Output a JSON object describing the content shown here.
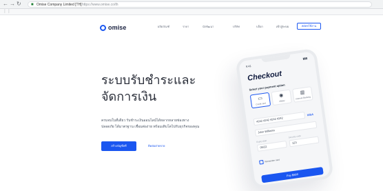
{
  "browser": {
    "back_icon": "back-arrow-icon",
    "forward_icon": "forward-arrow-icon",
    "reload_icon": "reload-icon",
    "lock_icon": "lock-icon",
    "site_label": "Omise Company Limited [TH]",
    "url": "https://www.omise.co/th"
  },
  "site": {
    "brand": "omise",
    "nav": [
      "ผลิตภัณฑ์",
      "ราคา",
      "นักพัฒนา",
      "บริษัท",
      "บล็อก"
    ],
    "login": "เข้าสู่ระบบ",
    "signup": "สมัครใช้งาน"
  },
  "hero": {
    "title_line1": "ระบบรับชำระและ",
    "title_line2": "จัดการเงิน",
    "subtitle_line1": "ครบจบในที่เดียว รับชำระเงินออนไลน์ได้หลากหลายช่องทาง",
    "subtitle_line2": "ปลอดภัย ได้มาตรฐาน เชื่อมต่อง่าย พร้อมเติบโตไปกับธุรกิจของคุณ",
    "cta_primary": "สร้างบัญชีฟรี",
    "cta_secondary": "ติดต่อฝ่ายขาย"
  },
  "phone": {
    "time": "9:41",
    "signal": "▮▮▮",
    "checkout_title": "Checkout",
    "payment_label": "Select your payment option",
    "payment_options": [
      "Credit card",
      "Alipay",
      "Internet Banking"
    ],
    "card_number": "4242 4242 4242 4242",
    "card_brand": "VISA",
    "name_on_card": "John Williams",
    "expiry_label": "Expiry date",
    "expiry": "05/22",
    "cvv_label": "Security code",
    "cvv": "123",
    "remember": "Remember card",
    "pay_button": "Pay ฿800"
  },
  "colors": {
    "brand_blue": "#1a56f0",
    "heading": "#2b2f3a",
    "background": "#ffffff"
  }
}
